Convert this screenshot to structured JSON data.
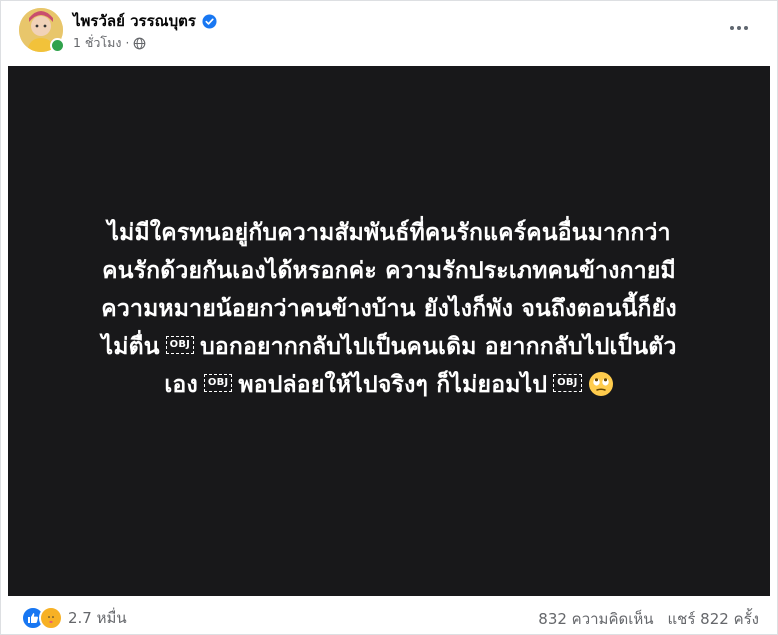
{
  "post": {
    "author": "ไพรวัลย์ วรรณบุตร",
    "time": "1 ชั่วโมง",
    "separator": "·",
    "lines": [
      "ไม่มีใครทนอยู่กับความสัมพันธ์ที่คนรักแคร์คนอื่นมากกว่า",
      "คนรักด้วยกันเองได้หรอกค่ะ ความรักประเภทคนข้างกายมี",
      "ความหมายน้อยกว่าคนข้างบ้าน ยังไงก็พัง จนถึงตอนนี้ก็ยัง",
      "ไม่ตื่น",
      "บอกอยากกลับไปเป็นคนเดิม อยากกลับไปเป็นตัว",
      "เอง",
      "พอปล่อยให้ไปจริงๆ ก็ไม่ยอมไป"
    ],
    "obj_label": "OBJ"
  },
  "footer": {
    "reaction_count": "2.7 หมื่น",
    "comments": "832 ความคิดเห็น",
    "shares": "แชร์ 822 ครั้ง"
  },
  "colors": {
    "content_bg": "#18181a",
    "accent": "#1877f2",
    "online": "#31a24c",
    "muted_text": "#65676b"
  }
}
